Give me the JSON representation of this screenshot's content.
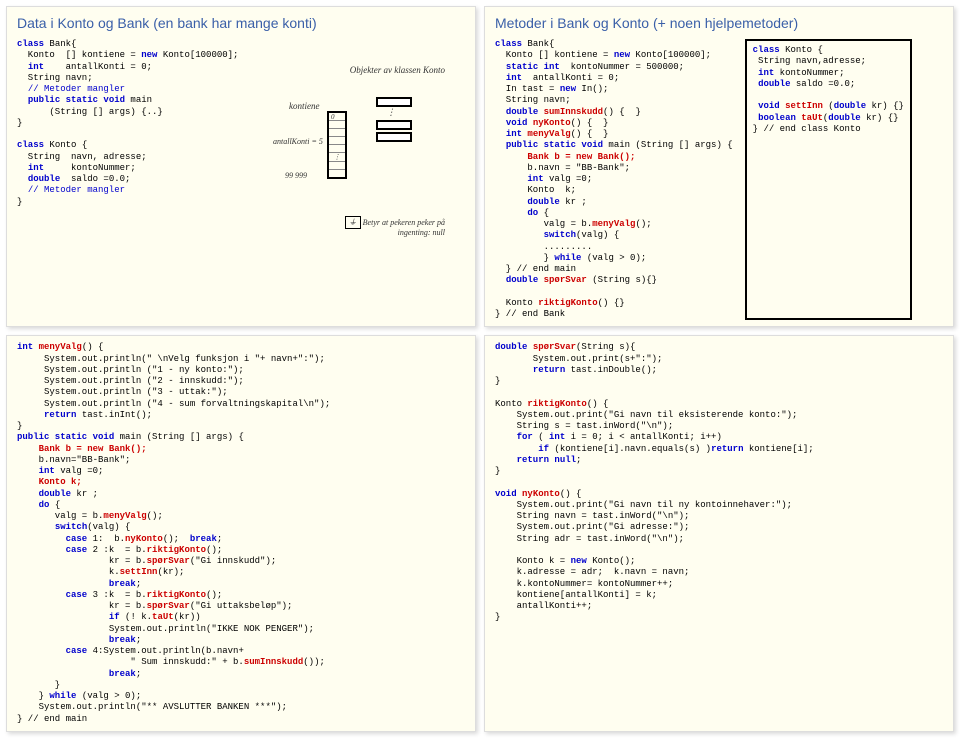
{
  "topLeft": {
    "title": "Data i Konto og Bank (en bank har mange konti)",
    "diagramLabels": {
      "objekter": "Objekter av klassen Konto",
      "kontiene": "kontiene",
      "zero": "0",
      "antallKonti": "antallKonti = 5",
      "max": "99 999",
      "null": "Betyr at pekeren peker på ingenting: null"
    }
  },
  "topRight": {
    "title": "Metoder i Bank og Konto (+ noen hjelpemetoder)"
  }
}
